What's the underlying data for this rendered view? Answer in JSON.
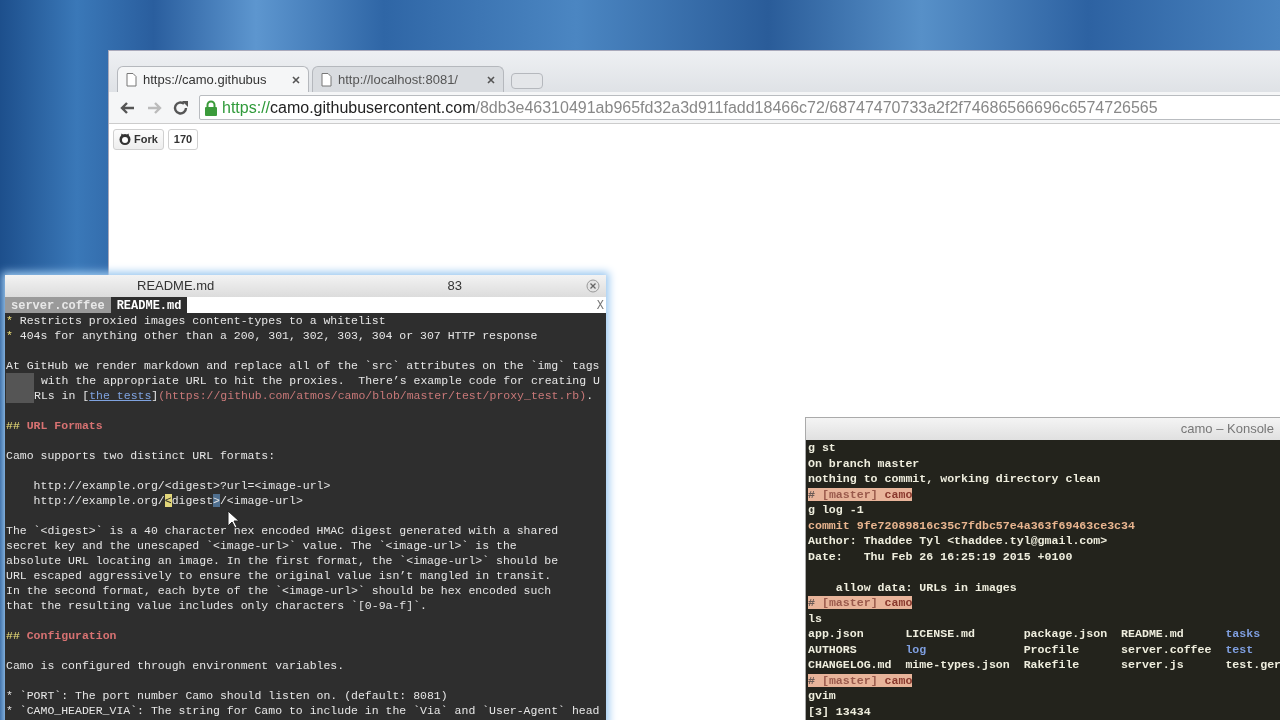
{
  "browser": {
    "tabs": [
      {
        "label": "https://camo.githubus",
        "selected": true
      },
      {
        "label": "http://localhost:8081/",
        "selected": false
      }
    ],
    "nav": {
      "back_disabled": false,
      "forward_disabled": true
    },
    "address": {
      "scheme": "https://",
      "host": "camo.githubusercontent.com",
      "path": "/8db3e46310491ab965fd32a3d911fadd18466c72/68747470733a2f2f74686566696c6574726565"
    },
    "page": {
      "fork_label": "Fork",
      "fork_count": "170"
    }
  },
  "editor": {
    "title": "README.md",
    "counter": "83",
    "buffers": [
      {
        "label": "server.coffee",
        "selected": false
      },
      {
        "label": "README.md",
        "selected": true
      }
    ],
    "tabline_close": "X",
    "lines": [
      {
        "segments": [
          {
            "text": "*",
            "kind": "bullet"
          },
          {
            "text": " Restricts proxied images content-types to a whitelist",
            "kind": "text"
          }
        ]
      },
      {
        "segments": [
          {
            "text": "*",
            "kind": "bullet"
          },
          {
            "text": " 404s for anything other than a 200, 301, 302, 303, 304 or 307 HTTP response",
            "kind": "text"
          }
        ]
      },
      {
        "kind": "blank"
      },
      {
        "segments": [
          {
            "text": "At GitHub we render markdown and replace all of the `src` attributes on the `img` tags",
            "kind": "text"
          }
        ]
      },
      {
        "wrap": true,
        "segments": [
          {
            "text": " with the appropriate URL to hit the proxies.  There’s example code for creating U",
            "kind": "text"
          }
        ]
      },
      {
        "wrap": true,
        "segments": [
          {
            "text": "RLs in [",
            "kind": "text"
          },
          {
            "text": "the tests",
            "kind": "link"
          },
          {
            "text": "]",
            "kind": "text"
          },
          {
            "text": "(https://github.com/atmos/camo/blob/master/test/proxy_test.rb)",
            "kind": "url"
          },
          {
            "text": ".",
            "kind": "text"
          }
        ]
      },
      {
        "kind": "blank"
      },
      {
        "segments": [
          {
            "text": "## ",
            "kind": "bullet"
          },
          {
            "text": "URL Formats",
            "kind": "heading"
          }
        ]
      },
      {
        "kind": "blank"
      },
      {
        "segments": [
          {
            "text": "Camo supports two distinct URL formats:",
            "kind": "text"
          }
        ]
      },
      {
        "kind": "blank"
      },
      {
        "segments": [
          {
            "text": "    http://example.org/<digest>?url=<image-url>",
            "kind": "text"
          }
        ]
      },
      {
        "segments": [
          {
            "text": "    http://example.org/",
            "kind": "text"
          },
          {
            "text": "<",
            "kind": "cursor"
          },
          {
            "text": "digest",
            "kind": "text"
          },
          {
            "text": ">",
            "kind": "match"
          },
          {
            "text": "/<image-url>",
            "kind": "text"
          }
        ]
      },
      {
        "kind": "blank"
      },
      {
        "segments": [
          {
            "text": "The `<digest>` is a 40 character hex encoded HMAC digest generated with a shared",
            "kind": "text"
          }
        ]
      },
      {
        "segments": [
          {
            "text": "secret key and the unescaped `<image-url>` value. The `<image-url>` is the",
            "kind": "text"
          }
        ]
      },
      {
        "segments": [
          {
            "text": "absolute URL locating an image. In the first format, the `<image-url>` should be",
            "kind": "text"
          }
        ]
      },
      {
        "segments": [
          {
            "text": "URL escaped aggressively to ensure the original value isn’t mangled in transit.",
            "kind": "text"
          }
        ]
      },
      {
        "segments": [
          {
            "text": "In the second format, each byte of the `<image-url>` should be hex encoded such",
            "kind": "text"
          }
        ]
      },
      {
        "segments": [
          {
            "text": "that the resulting value includes only characters `[0-9a-f]`.",
            "kind": "text"
          }
        ]
      },
      {
        "kind": "blank"
      },
      {
        "segments": [
          {
            "text": "## ",
            "kind": "bullet"
          },
          {
            "text": "Configuration",
            "kind": "heading"
          }
        ]
      },
      {
        "kind": "blank"
      },
      {
        "segments": [
          {
            "text": "Camo is configured through environment variables.",
            "kind": "text"
          }
        ]
      },
      {
        "kind": "blank"
      },
      {
        "segments": [
          {
            "text": "* `PORT`: The port number Camo should listen on. (default: 8081)",
            "kind": "text"
          }
        ]
      },
      {
        "segments": [
          {
            "text": "* `CAMO_HEADER_VIA`: The string for Camo to include in the `Via` and `User-Agent` head",
            "kind": "text"
          }
        ]
      }
    ]
  },
  "konsole": {
    "title": "camo – Konsole",
    "lines": [
      {
        "kind": "text",
        "text": "g st"
      },
      {
        "kind": "text",
        "text": "On branch master"
      },
      {
        "kind": "text",
        "text": "nothing to commit, working directory clean"
      },
      {
        "kind": "prompt",
        "hash": "#",
        "branch": "[master]",
        "dir": "camo"
      },
      {
        "kind": "text",
        "text": "g log -1"
      },
      {
        "kind": "commit",
        "text": "commit 9fe72089816c35c7fdbc57e4a363f69463ce3c34"
      },
      {
        "kind": "text",
        "text": "Author: Thaddee Tyl <thaddee.tyl@gmail.com>"
      },
      {
        "kind": "text",
        "text": "Date:   Thu Feb 26 16:25:19 2015 +0100"
      },
      {
        "kind": "blank"
      },
      {
        "kind": "text",
        "text": "    allow data: URLs in images"
      },
      {
        "kind": "prompt",
        "hash": "#",
        "branch": "[master]",
        "dir": "camo"
      },
      {
        "kind": "text",
        "text": "ls"
      },
      {
        "kind": "columns",
        "cells": [
          {
            "text": "app.json",
            "dir": false
          },
          {
            "text": "LICENSE.md",
            "dir": false
          },
          {
            "text": "package.json",
            "dir": false
          },
          {
            "text": "README.md",
            "dir": false
          },
          {
            "text": "tasks",
            "dir": true
          }
        ]
      },
      {
        "kind": "columns",
        "cells": [
          {
            "text": "AUTHORS",
            "dir": false
          },
          {
            "text": "log",
            "dir": true
          },
          {
            "text": "Procfile",
            "dir": false
          },
          {
            "text": "server.coffee",
            "dir": false
          },
          {
            "text": "test",
            "dir": true
          }
        ]
      },
      {
        "kind": "columns",
        "cells": [
          {
            "text": "CHANGELOG.md",
            "dir": false
          },
          {
            "text": "mime-types.json",
            "dir": false
          },
          {
            "text": "Rakefile",
            "dir": false
          },
          {
            "text": "server.js",
            "dir": false
          },
          {
            "text": "test.ger",
            "dir": false
          }
        ]
      },
      {
        "kind": "prompt",
        "hash": "#",
        "branch": "[master]",
        "dir": "camo"
      },
      {
        "kind": "text",
        "text": "gvim"
      },
      {
        "kind": "text",
        "text": "[3] 13434"
      }
    ]
  }
}
